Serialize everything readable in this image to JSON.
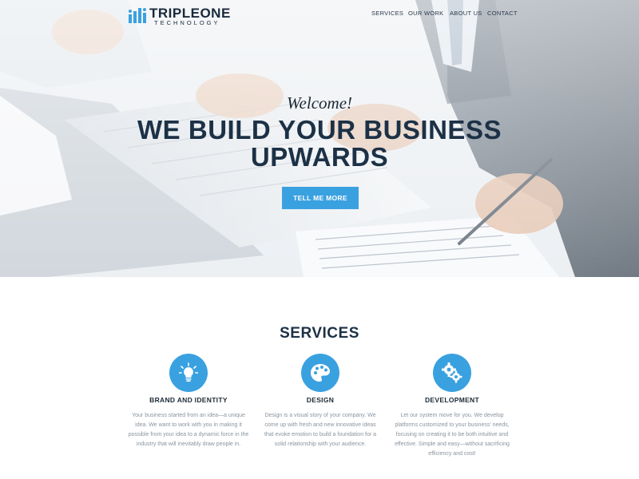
{
  "brand": {
    "name": "TRIPLEONE",
    "tagline": "TECHNOLOGY"
  },
  "nav": {
    "items": [
      "SERVICES",
      "OUR WORK",
      "ABOUT US",
      "CONTACT"
    ]
  },
  "hero": {
    "welcome": "Welcome!",
    "headline_line1": "WE BUILD YOUR BUSINESS",
    "headline_line2": "UPWARDS",
    "cta_label": "TELL ME MORE"
  },
  "services": {
    "title": "SERVICES",
    "items": [
      {
        "icon": "lightbulb-icon",
        "title": "BRAND AND IDENTITY",
        "text": "Your business started from an idea—a unique idea. We want to work with you in making it possible from your idea to a dynamic force in the industry that will inevitably draw people in."
      },
      {
        "icon": "palette-icon",
        "title": "DESIGN",
        "text": "Design is a visual story of your company. We come up with fresh and new innovative ideas that evoke emotion to build a foundation for a solid relationship with your audience."
      },
      {
        "icon": "gears-icon",
        "title": "DEVELOPMENT",
        "text": "Let our system move for you. We develop platforms customized to your business' needs, focusing on creating it to be both intuitive and effective. Simple and easy—without sacrificing efficiency and cost!"
      }
    ]
  },
  "colors": {
    "accent": "#3aa1e0",
    "heading": "#1c3146",
    "body_text": "#8a949e"
  }
}
